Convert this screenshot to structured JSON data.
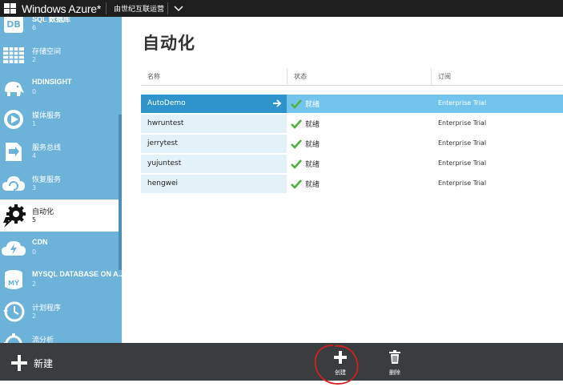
{
  "topbar": {
    "brand": "Windows Azure*",
    "tenant": "由世纪互联运营"
  },
  "sidebar": {
    "items": [
      {
        "icon": "database-icon",
        "label": "SQL 数据库",
        "count": "6"
      },
      {
        "icon": "storage-table-icon",
        "label": "存储空间",
        "count": "2"
      },
      {
        "icon": "elephant-icon",
        "label": "HDINSIGHT",
        "count": "0"
      },
      {
        "icon": "media-play-icon",
        "label": "媒体服务",
        "count": "1"
      },
      {
        "icon": "service-bus-icon",
        "label": "服务总线",
        "count": "4"
      },
      {
        "icon": "recovery-cloud-icon",
        "label": "恢复服务",
        "count": "3"
      },
      {
        "icon": "automation-gear-icon",
        "label": "自动化",
        "count": "5"
      },
      {
        "icon": "cdn-cloud-icon",
        "label": "CDN",
        "count": "0"
      },
      {
        "icon": "mysql-icon",
        "label": "MYSQL DATABASE ON A...",
        "count": "2"
      },
      {
        "icon": "clock-icon",
        "label": "计划程序",
        "count": "2"
      },
      {
        "icon": "analytics-icon",
        "label": "流分析",
        "count": ""
      }
    ]
  },
  "main": {
    "title": "自动化",
    "columns": [
      "名称",
      "状态",
      "订阅"
    ],
    "rows": [
      {
        "name": "AutoDemo",
        "status": "就绪",
        "subscription": "Enterprise Trial"
      },
      {
        "name": "hwruntest",
        "status": "就绪",
        "subscription": "Enterprise Trial"
      },
      {
        "name": "jerrytest",
        "status": "就绪",
        "subscription": "Enterprise Trial"
      },
      {
        "name": "yujuntest",
        "status": "就绪",
        "subscription": "Enterprise Trial"
      },
      {
        "name": "hengwei",
        "status": "就绪",
        "subscription": "Enterprise Trial"
      }
    ]
  },
  "bottombar": {
    "new_label": "新建",
    "create_label": "创建",
    "delete_label": "删除"
  },
  "colors": {
    "sidebar": "#6db2d8",
    "selected_row": "#2f94cc",
    "selected_row_band": "#73c4ec",
    "bottombar": "#3a3d40",
    "check": "#52b043",
    "annotation": "#d32020"
  }
}
